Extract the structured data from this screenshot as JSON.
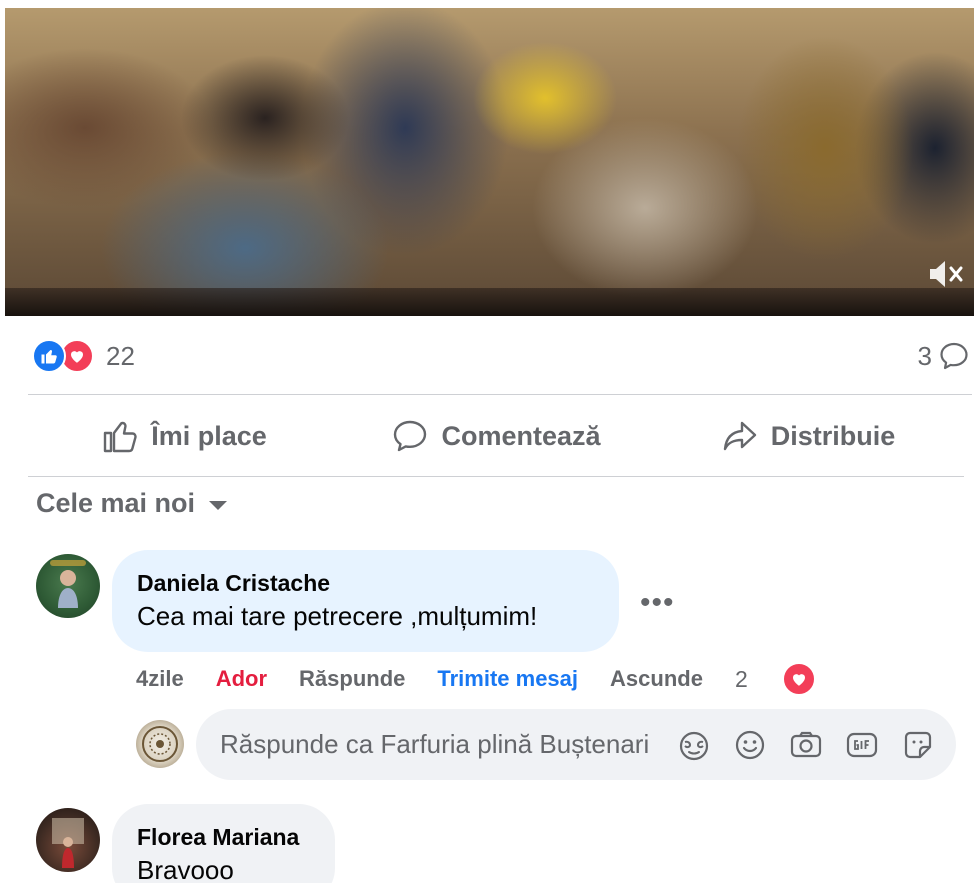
{
  "video": {
    "mute_icon": "speaker-muted-icon"
  },
  "reactions": {
    "icons": [
      "like-icon",
      "love-icon"
    ],
    "count": "22",
    "comments_count": "3"
  },
  "actions": {
    "like_label": "Îmi place",
    "comment_label": "Comentează",
    "share_label": "Distribuie"
  },
  "sort": {
    "label": "Cele mai noi"
  },
  "comments": [
    {
      "author": "Daniela Cristache",
      "text": "Cea mai tare petrecere ,mulțumim!",
      "time": "4zile",
      "reaction_label": "Ador",
      "reply_label": "Răspunde",
      "message_label": "Trimite mesaj",
      "hide_label": "Ascunde",
      "reaction_count": "2"
    },
    {
      "author": "Florea Mariana",
      "text": "Bravooo"
    }
  ],
  "reply_box": {
    "placeholder": "Răspunde ca Farfuria plină Buștenari"
  },
  "colors": {
    "accent_blue": "#1877f2",
    "love_red": "#f33e58",
    "ador_red": "#e41e3f",
    "secondary_text": "#65676b",
    "bubble_bg": "#f0f2f5"
  }
}
